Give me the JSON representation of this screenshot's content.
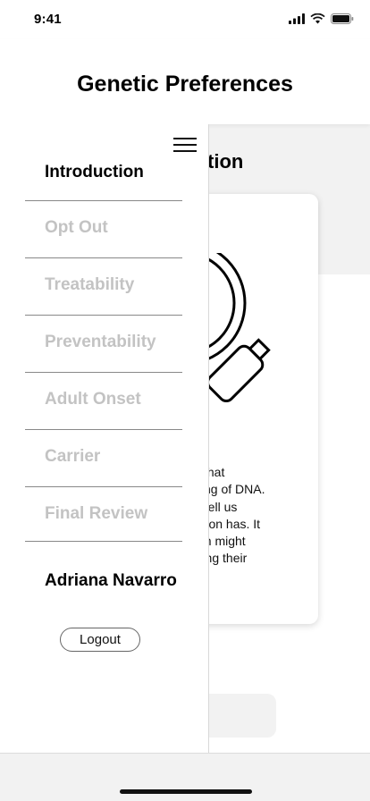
{
  "status_bar": {
    "time": "9:41",
    "icons": [
      "signal-icon",
      "wifi-icon",
      "battery-icon"
    ]
  },
  "header": {
    "title": "Genetic Preferences"
  },
  "main": {
    "section_heading_visible": "tion",
    "card": {
      "illustration": "magnifying-glass-icon",
      "text_lines": [
        "ly that",
        "sting of DNA.",
        "ld tell us",
        "erson has. It",
        "son might",
        "uring their"
      ]
    }
  },
  "drawer": {
    "menu_icon": "hamburger-icon",
    "nav_items": [
      {
        "label": "Introduction",
        "state": "active"
      },
      {
        "label": "Opt Out",
        "state": "disabled"
      },
      {
        "label": "Treatability",
        "state": "disabled"
      },
      {
        "label": "Preventability",
        "state": "disabled"
      },
      {
        "label": "Adult Onset",
        "state": "disabled"
      },
      {
        "label": "Carrier",
        "state": "disabled"
      },
      {
        "label": "Final Review",
        "state": "disabled"
      }
    ],
    "user_name": "Adriana Navarro",
    "logout_label": "Logout"
  },
  "colors": {
    "active_text": "#000000",
    "disabled_text": "#c3c3c3",
    "band_background": "#f2f2f2"
  }
}
